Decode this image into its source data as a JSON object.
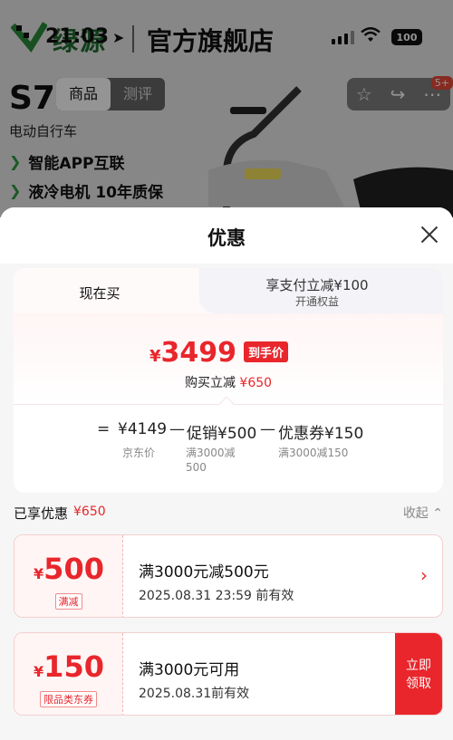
{
  "status_bar": {
    "time": "21:03",
    "battery": "100"
  },
  "store": {
    "brand": "绿源",
    "title": "官方旗舰店"
  },
  "product": {
    "model": "S7",
    "category": "电动自行车",
    "features": [
      "智能APP互联",
      "液冷电机 10年质保"
    ],
    "nav_tabs": [
      "商品",
      "测评"
    ],
    "badge": "5+"
  },
  "sheet": {
    "title": "优惠",
    "tabs": {
      "current": "现在买",
      "alt_main": "享支付立减¥100",
      "alt_sub": "开通权益"
    },
    "final_price": {
      "currency": "¥",
      "amount": "3499",
      "tag": "到手价"
    },
    "discount_line": {
      "label": "购买立减",
      "amount": "¥650"
    },
    "formula": {
      "eq": "=",
      "base": "¥4149",
      "minus1": "—",
      "promo": "促销¥500",
      "minus2": "—",
      "coupon": "优惠券¥150",
      "base_label": "京东价",
      "promo_label": "满3000减500",
      "coupon_label": "满3000减150"
    },
    "enjoyed": {
      "label": "已享优惠",
      "amount": "¥650",
      "collapse": "收起 ⌃"
    },
    "coupons": [
      {
        "currency": "¥",
        "amount": "500",
        "tag": "满减",
        "title": "满3000元减500元",
        "expiry": "2025.08.31 23:59 前有效",
        "action": "›"
      },
      {
        "currency": "¥",
        "amount": "150",
        "tag": "限品类东券",
        "title": "满3000元可用",
        "expiry": "2025.08.31前有效",
        "action": "立即领取"
      }
    ]
  }
}
